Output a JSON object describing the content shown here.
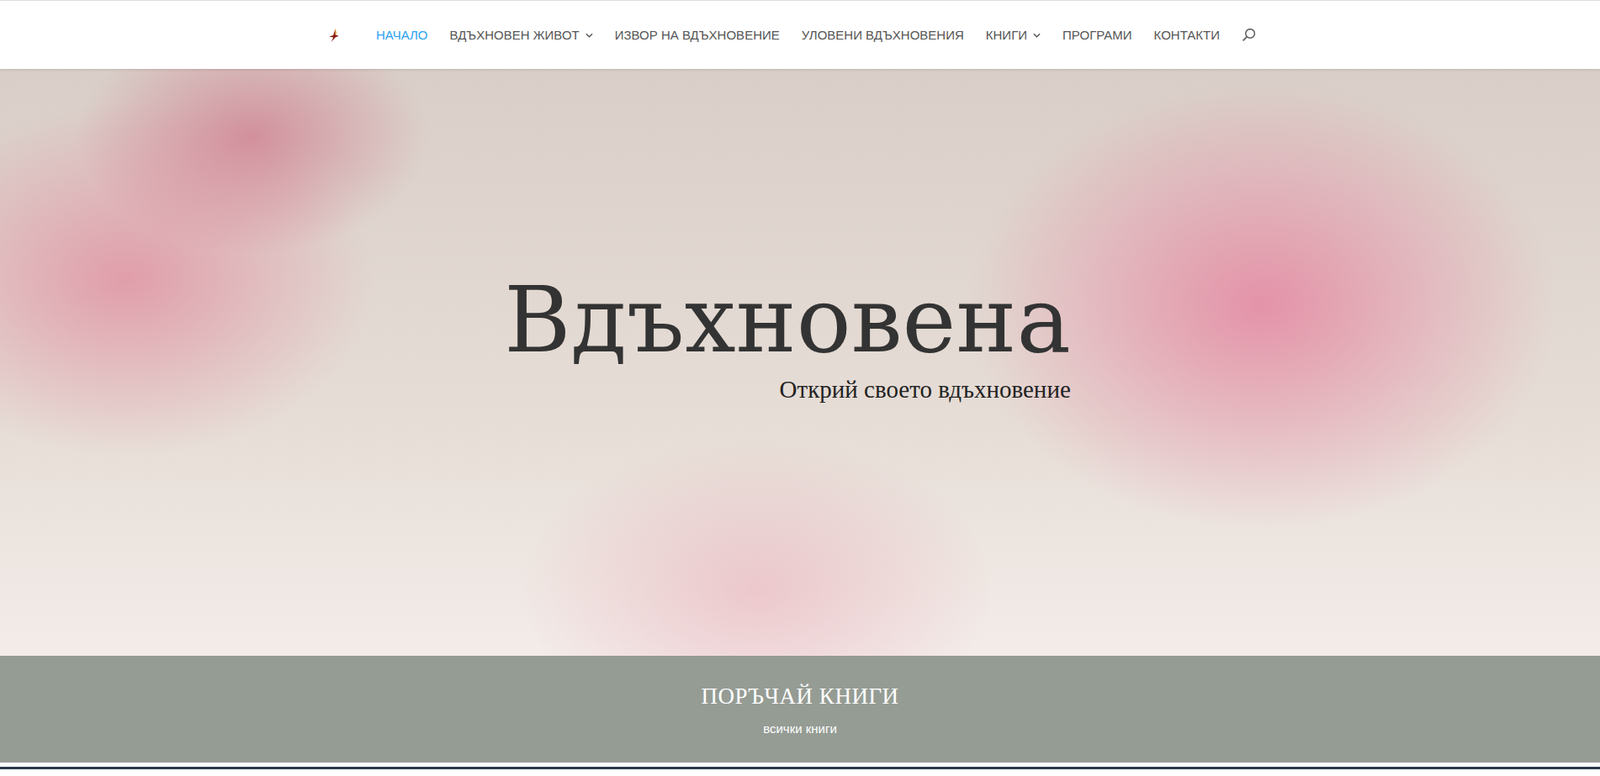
{
  "nav": {
    "items": [
      {
        "label": "НАЧАЛО",
        "selected": true,
        "dropdown": false
      },
      {
        "label": "ВДЪХНОВЕН ЖИВОТ",
        "selected": false,
        "dropdown": true
      },
      {
        "label": "ИЗВОР НА ВДЪХНОВЕНИЕ",
        "selected": false,
        "dropdown": false
      },
      {
        "label": "УЛОВЕНИ ВДЪХНОВЕНИЯ",
        "selected": false,
        "dropdown": false
      },
      {
        "label": "КНИГИ",
        "selected": false,
        "dropdown": true
      },
      {
        "label": "ПРОГРАМИ",
        "selected": false,
        "dropdown": false
      },
      {
        "label": "КОНТАКТИ",
        "selected": false,
        "dropdown": false
      }
    ]
  },
  "hero": {
    "title": "Вдъхновена",
    "subtitle": "Открий своето вдъхновение"
  },
  "books_band": {
    "title": "ПОРЪЧАЙ КНИГИ",
    "link": "всички книги"
  }
}
